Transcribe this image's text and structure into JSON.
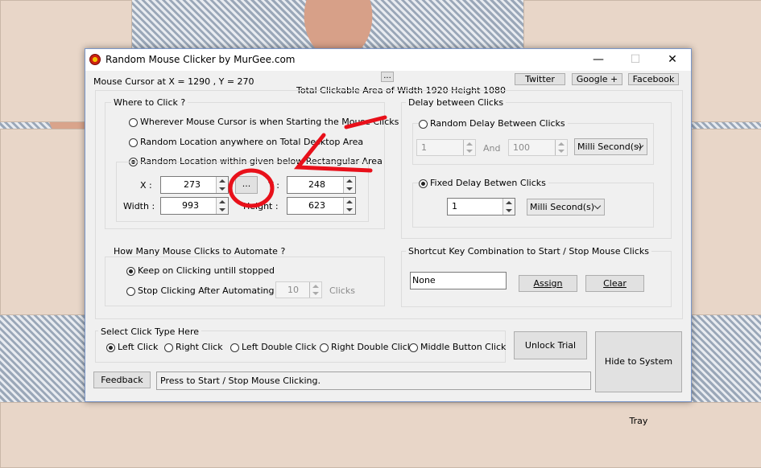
{
  "window": {
    "title": "Random Mouse Clicker by MurGee.com",
    "minimize": "—",
    "maximize": "☐",
    "close": "✕"
  },
  "header": {
    "cursor_position": "Mouse Cursor at X = 1290 , Y = 270",
    "top_dots_button": "...",
    "clickable_area": "Total Clickable Area of Width 1920 Height 1080",
    "twitter": "Twitter",
    "google": "Google +",
    "facebook": "Facebook"
  },
  "where_to_click": {
    "label": "Where to Click ?",
    "option1": "Wherever Mouse Cursor is when Starting the Mouse Clicks",
    "option2": "Random Location anywhere on Total Desktop Area",
    "option3": "Random Location within given below Rectangular Area",
    "selected": "option3",
    "x_label": "X :",
    "x_value": "273",
    "y_label": "Y :",
    "y_value": "248",
    "width_label": "Width :",
    "width_value": "993",
    "height_label": "Height :",
    "height_value": "623",
    "pick_button": "..."
  },
  "delay": {
    "label": "Delay between Clicks",
    "random_label": "Random Delay Between Clicks",
    "random_min": "1",
    "and_label": "And",
    "random_max": "100",
    "random_unit": "Milli Second(s)",
    "fixed_label": "Fixed Delay Betwen Clicks",
    "fixed_value": "1",
    "fixed_unit": "Milli Second(s)"
  },
  "how_many": {
    "label": "How Many Mouse Clicks to Automate ?",
    "keep_clicking": "Keep on Clicking untill stopped",
    "stop_after": "Stop Clicking After Automating",
    "count": "10",
    "clicks_label": "Clicks"
  },
  "shortcut": {
    "label": "Shortcut Key Combination to Start / Stop Mouse Clicks",
    "value": "None",
    "assign": "Assign",
    "clear": "Clear"
  },
  "click_type": {
    "label": "Select Click Type Here",
    "left": "Left Click",
    "right": "Right Click",
    "left_double": "Left Double Click",
    "right_double": "Right Double Click",
    "middle": "Middle Button Click"
  },
  "footer": {
    "unlock": "Unlock Trial",
    "hide": "Hide to System Tray",
    "feedback": "Feedback",
    "status": "Press  to Start / Stop Mouse Clicking."
  },
  "colors": {
    "annotation": "#e8101a",
    "window_border": "#7a96c8"
  }
}
